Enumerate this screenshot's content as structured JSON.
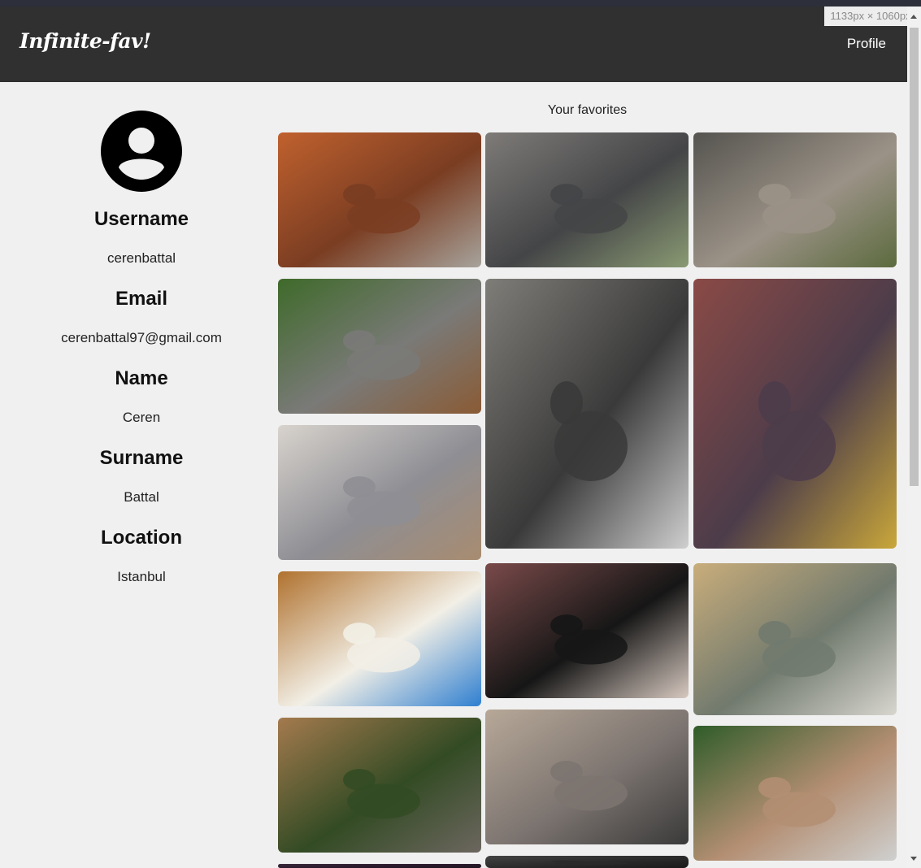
{
  "navbar": {
    "brand": "Infinite-fav!",
    "profile_link": "Profile"
  },
  "devtools": {
    "size_readout": "1133px × 1060px"
  },
  "profile": {
    "avatar_icon": "account-circle-icon",
    "fields": [
      {
        "label": "Username",
        "value": "cerenbattal"
      },
      {
        "label": "Email",
        "value": "cerenbattal97@gmail.com"
      },
      {
        "label": "Name",
        "value": "Ceren"
      },
      {
        "label": "Surname",
        "value": "Battal"
      },
      {
        "label": "Location",
        "value": "Istanbul"
      }
    ]
  },
  "favorites": {
    "title": "Your favorites",
    "photos": [
      {
        "subject": "tabby cat lying in autumn leaves",
        "colors": [
          "#7a3d22",
          "#c0612e",
          "#a7a39c"
        ]
      },
      {
        "subject": "two cats by a fence on a paved path",
        "colors": [
          "#444547",
          "#7e7b78",
          "#8a9a73"
        ]
      },
      {
        "subject": "tabby cat under a bench",
        "colors": [
          "#9b9287",
          "#55544f",
          "#5c6b3e"
        ]
      },
      {
        "subject": "tortoiseshell cat walking on pavement",
        "colors": [
          "#7a7a78",
          "#3f6a2a",
          "#8a5b35"
        ]
      },
      {
        "subject": "grey tabby cat sleeping on a bin lid",
        "colors": [
          "#3a3a3a",
          "#7f7d78",
          "#cfcfcf"
        ]
      },
      {
        "subject": "cat with a plush toy on a rug",
        "colors": [
          "#4c3c4a",
          "#8a4a46",
          "#c9a73a"
        ]
      },
      {
        "subject": "grey cat crouching on a wooden floor",
        "colors": [
          "#8e8e94",
          "#d8d3cd",
          "#a88c70"
        ]
      },
      {
        "subject": "white cat with orange spots in the sun",
        "colors": [
          "#f2efe6",
          "#b0722f",
          "#2f7fd0"
        ]
      },
      {
        "subject": "black cat with yellow eyes",
        "colors": [
          "#161616",
          "#7a4a4a",
          "#d7c9c0"
        ]
      },
      {
        "subject": "grey cat inside a paper bag",
        "colors": [
          "#717a6e",
          "#c9ad7b",
          "#d8d6cf"
        ]
      },
      {
        "subject": "cat sitting under a stone bench",
        "colors": [
          "#334b24",
          "#a47a4e",
          "#6c665f"
        ]
      },
      {
        "subject": "grey cat lying on a cushion",
        "colors": [
          "#7c7470",
          "#b7a898",
          "#3a3a3a"
        ]
      },
      {
        "subject": "white and brown cat on a brick walkway",
        "colors": [
          "#b38e72",
          "#2f5c2a",
          "#cfd0cf"
        ]
      },
      {
        "subject": "dark photo (partially visible)",
        "colors": [
          "#2b1a2c",
          "#3a2a3b",
          "#1d141e"
        ]
      },
      {
        "subject": "dark photo (partially visible)",
        "colors": [
          "#2a2a2a",
          "#444444",
          "#1a1a1a"
        ]
      }
    ]
  }
}
